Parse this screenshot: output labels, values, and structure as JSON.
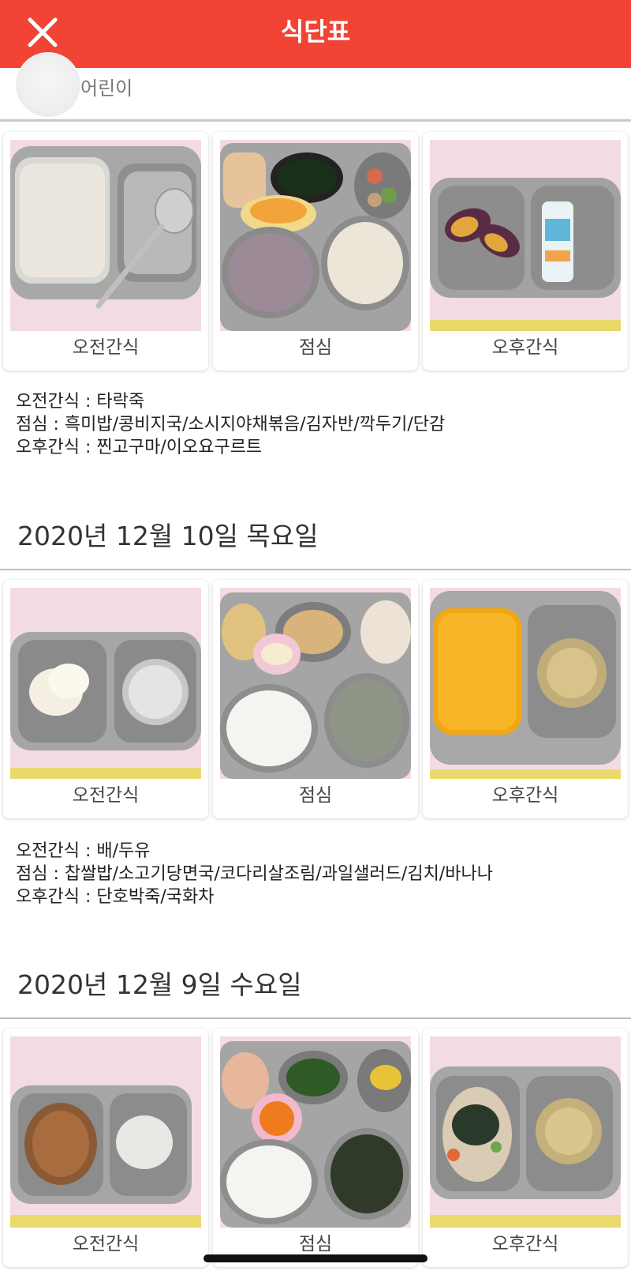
{
  "header": {
    "title": "식단표",
    "close_icon": "close-icon",
    "background_color": "#f24435"
  },
  "user": {
    "name": "어린이"
  },
  "days": [
    {
      "date": "",
      "meals": [
        {
          "label": "오전간식",
          "photo": "porridge-tray"
        },
        {
          "label": "점심",
          "photo": "lunch-tray"
        },
        {
          "label": "오후간식",
          "photo": "sweet-potato-yogurt-tray"
        }
      ],
      "menu": [
        "오전간식 : 타락죽",
        "점심 : 흑미밥/콩비지국/소시지야채볶음/김자반/깍두기/단감",
        "오후간식 : 찐고구마/이오요구르트"
      ]
    },
    {
      "date": "2020년 12월 10일 목요일",
      "meals": [
        {
          "label": "오전간식",
          "photo": "pear-soymilk-tray"
        },
        {
          "label": "점심",
          "photo": "lunch-tray"
        },
        {
          "label": "오후간식",
          "photo": "pumpkin-porridge-tray"
        }
      ],
      "menu": [
        "오전간식 : 배/두유",
        "점심 : 찹쌀밥/소고기당면국/코다리살조림/과일샐러드/김치/바나나",
        "오후간식 : 단호박죽/국화차"
      ]
    },
    {
      "date": "2020년 12월 9일 수요일",
      "meals": [
        {
          "label": "오전간식",
          "photo": "cereal-milk-tray"
        },
        {
          "label": "점심",
          "photo": "lunch-tray"
        },
        {
          "label": "오후간식",
          "photo": "noodle-tea-tray"
        }
      ],
      "menu": []
    }
  ]
}
